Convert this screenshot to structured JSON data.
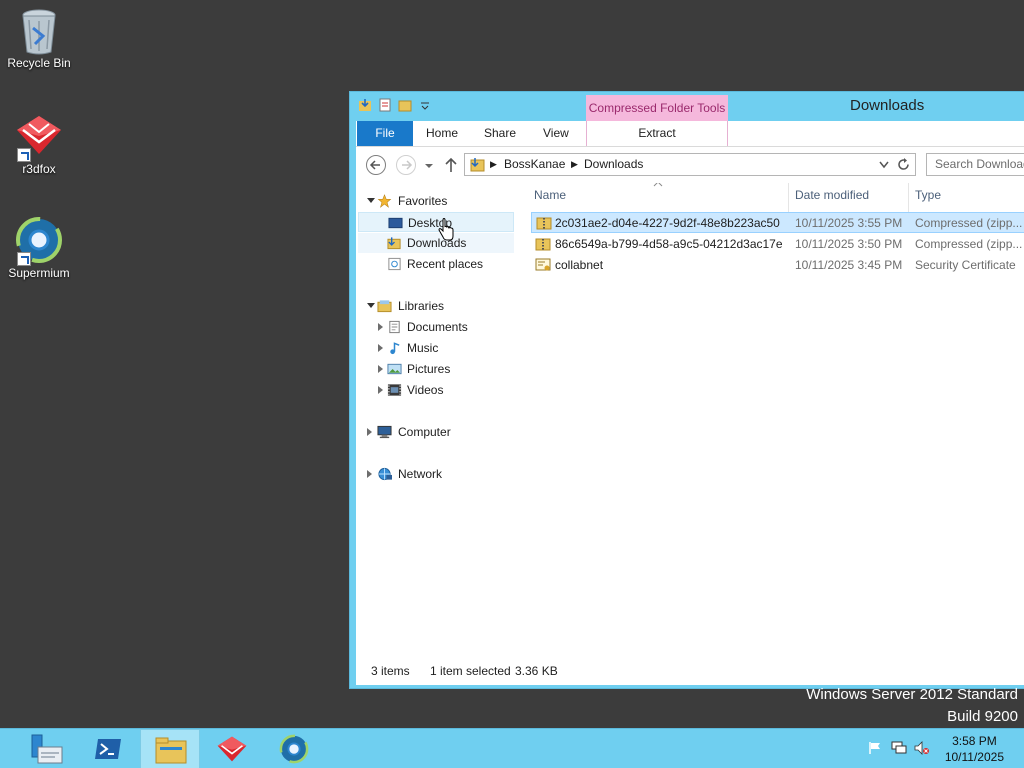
{
  "desktop": {
    "icons": [
      {
        "label": "Recycle Bin"
      },
      {
        "label": "r3dfox"
      },
      {
        "label": "Supermium"
      }
    ],
    "watermark": {
      "line1": "Windows Server 2012 Standard",
      "line2": "Build 9200"
    }
  },
  "window": {
    "title": "Downloads",
    "context_group": "Compressed Folder Tools",
    "ribbon_tabs": [
      "File",
      "Home",
      "Share",
      "View",
      "Extract"
    ],
    "address": {
      "crumbs": [
        "BossKanae",
        "Downloads"
      ]
    },
    "search_placeholder": "Search Downloads",
    "nav": {
      "favorites": "Favorites",
      "favorites_items": [
        "Desktop",
        "Downloads",
        "Recent places"
      ],
      "libraries": "Libraries",
      "libraries_items": [
        "Documents",
        "Music",
        "Pictures",
        "Videos"
      ],
      "computer": "Computer",
      "network": "Network"
    },
    "columns": [
      "Name",
      "Date modified",
      "Type"
    ],
    "files": [
      {
        "name": "2c031ae2-d04e-4227-9d2f-48e8b223ac50",
        "date": "10/11/2025 3:55 PM",
        "type": "Compressed (zipp...",
        "selected": true
      },
      {
        "name": "86c6549a-b799-4d58-a9c5-04212d3ac17e",
        "date": "10/11/2025 3:50 PM",
        "type": "Compressed (zipp...",
        "selected": false
      },
      {
        "name": "collabnet",
        "date": "10/11/2025 3:45 PM",
        "type": "Security Certificate",
        "selected": false
      }
    ],
    "status": {
      "items": "3 items",
      "selected": "1 item selected",
      "size": "3.36 KB"
    }
  },
  "taskbar": {
    "clock": {
      "time": "3:58 PM",
      "date": "10/11/2025"
    }
  },
  "colors": {
    "accent": "#6fcff0",
    "file_tab": "#1979ca",
    "context_tab": "#f5b8dc",
    "selection": "#cce8ff"
  }
}
